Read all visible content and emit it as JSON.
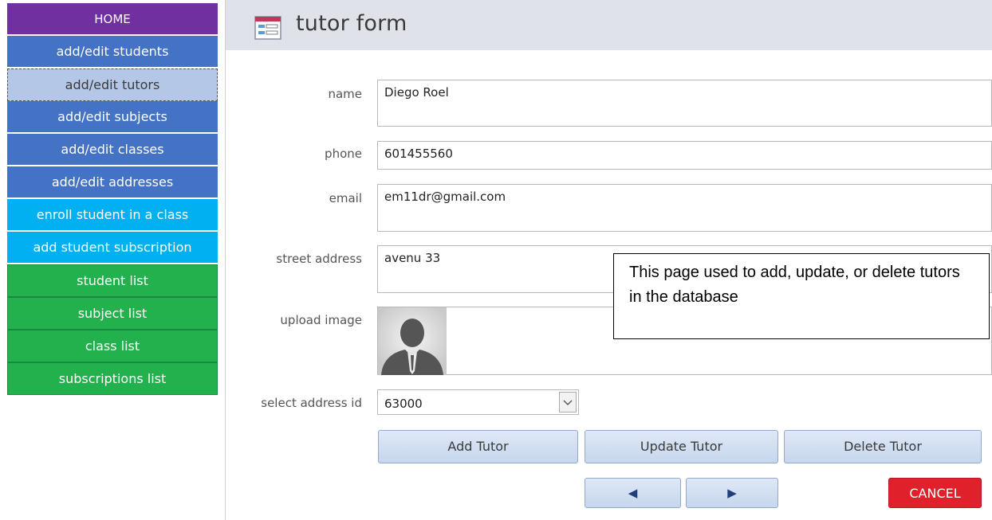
{
  "nav": {
    "items": [
      {
        "label": "HOME",
        "color": "#7030a0"
      },
      {
        "label": "add/edit students",
        "color": "#4472c4"
      },
      {
        "label": "add/edit tutors",
        "color": "#b4c7e7"
      },
      {
        "label": "add/edit subjects",
        "color": "#4472c4"
      },
      {
        "label": "add/edit classes",
        "color": "#4472c4"
      },
      {
        "label": "add/edit addresses",
        "color": "#4472c4"
      },
      {
        "label": "enroll student in a class",
        "color": "#00b0f0"
      },
      {
        "label": "add student subscription",
        "color": "#00b0f0"
      },
      {
        "label": "student list",
        "color": "#22b14c"
      },
      {
        "label": "subject list",
        "color": "#22b14c"
      },
      {
        "label": "class list",
        "color": "#22b14c"
      },
      {
        "label": "subscriptions list",
        "color": "#22b14c"
      }
    ],
    "selected_index": 2
  },
  "header": {
    "title": "tutor form",
    "icon": "form-icon"
  },
  "form": {
    "name_label": "name",
    "name_value": "Diego Roel",
    "phone_label": "phone",
    "phone_value": "601455560",
    "email_label": "email",
    "email_value": "em11dr@gmail.com",
    "street_label": "street address",
    "street_value": "avenu 33",
    "image_label": "upload image",
    "image_icon": "person-silhouette-icon",
    "address_label": "select address id",
    "address_value": "63000"
  },
  "buttons": {
    "add": "Add Tutor",
    "update": "Update Tutor",
    "delete": "Delete Tutor",
    "prev": "◀",
    "next": "▶",
    "cancel": "CANCEL",
    "cancel_color": "#e0202a"
  },
  "callout": {
    "text": "This page used to add, update, or delete tutors  in the database"
  }
}
